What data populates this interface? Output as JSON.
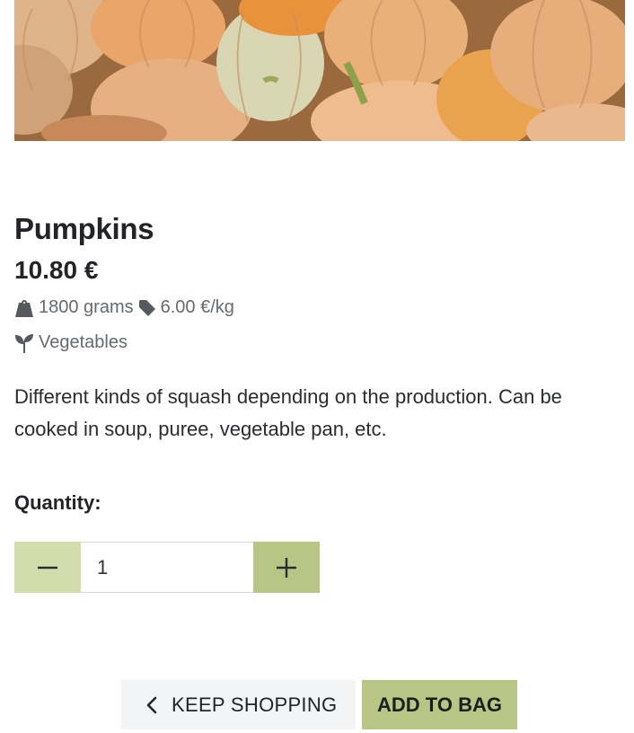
{
  "product": {
    "image_alt": "Pumpkins photo",
    "name": "Pumpkins",
    "price": "10.80 €",
    "weight": "1800 grams",
    "unit_price": "6.00 €/kg",
    "category": "Vegetables",
    "description": "Different kinds of squash depending on the production. Can be cooked in soup, puree, vegetable pan, etc."
  },
  "quantity": {
    "label": "Quantity:",
    "value": "1",
    "decrement_symbol": "−",
    "increment_symbol": "+"
  },
  "actions": {
    "keep_shopping": "KEEP SHOPPING",
    "add_to_bag": "ADD TO BAG"
  },
  "icons": {
    "weight": "weight-icon",
    "tag": "tag-icon",
    "category": "seedling-icon",
    "back": "chevron-left-icon",
    "minus": "minus-icon",
    "plus": "plus-icon"
  },
  "colors": {
    "accent": "#b8c585",
    "accent_light": "#d2dcac",
    "secondary_button": "#f3f4f6",
    "text": "#222428",
    "muted": "#666a70"
  }
}
